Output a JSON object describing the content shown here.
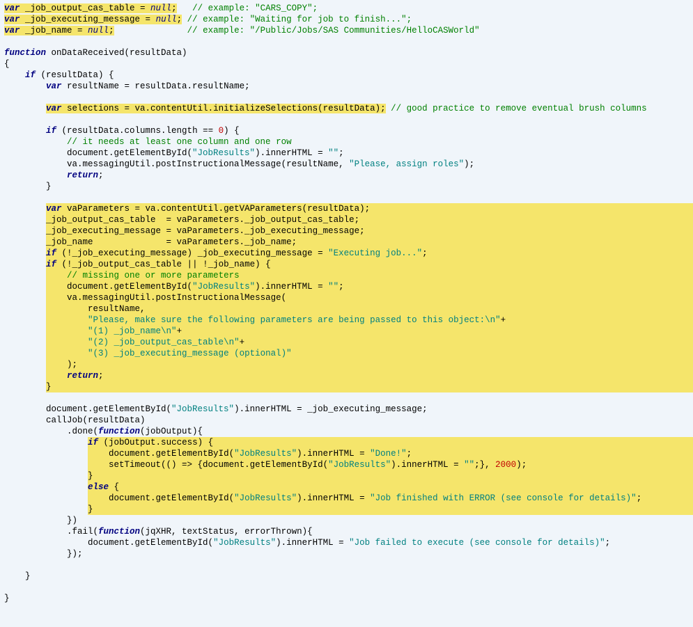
{
  "code": {
    "lines": [
      {
        "hl": true,
        "html": "<span class='kw'>var</span> _job_output_cas_table = <span class='null'>null</span>;",
        "trail": "   <span class='cmt'>// example: \"CARS_COPY\";</span>"
      },
      {
        "hl": true,
        "html": "<span class='kw'>var</span> _job_executing_message = <span class='null'>null</span>;",
        "trail": " <span class='cmt'>// example: \"Waiting for job to finish...\";</span>"
      },
      {
        "hl": true,
        "html": "<span class='kw'>var</span> _job_name = <span class='null'>null</span>;",
        "trail": "              <span class='cmt'>// example: \"/Public/Jobs/SAS Communities/HelloCASWorld\"</span>"
      },
      {
        "blank": true
      },
      {
        "html": "<span class='kw'>function</span> onDataReceived(resultData)"
      },
      {
        "html": "{"
      },
      {
        "html": "    <span class='kw'>if</span> (resultData) {"
      },
      {
        "html": "        <span class='kw'>var</span> resultName = resultData.resultName;"
      },
      {
        "blank": true
      },
      {
        "html": "        ",
        "inlinehl": "<span class='kw'>var</span> selections = va.contentUtil.initializeSelections(resultData);",
        "trail": " <span class='cmt'>// good practice to remove eventual brush columns</span>"
      },
      {
        "blank": true
      },
      {
        "html": "        <span class='kw'>if</span> (resultData.columns.length == <span class='num'>0</span>) {"
      },
      {
        "html": "            <span class='cmt'>// it needs at least one column and one row</span>"
      },
      {
        "html": "            document.getElementById(<span class='str'>\"JobResults\"</span>).innerHTML = <span class='str'>\"\"</span>;"
      },
      {
        "html": "            va.messagingUtil.postInstructionalMessage(resultName, <span class='str'>\"Please, assign roles\"</span>);"
      },
      {
        "html": "            <span class='kw'>return</span>;"
      },
      {
        "html": "        }"
      },
      {
        "blank": true
      },
      {
        "hlblock": true,
        "indent": "        ",
        "html": "<span class='kw'>var</span> vaParameters = va.contentUtil.getVAParameters(resultData);"
      },
      {
        "hlblock": true,
        "indent": "        ",
        "html": "_job_output_cas_table  = vaParameters._job_output_cas_table;"
      },
      {
        "hlblock": true,
        "indent": "        ",
        "html": "_job_executing_message = vaParameters._job_executing_message;"
      },
      {
        "hlblock": true,
        "indent": "        ",
        "html": "_job_name              = vaParameters._job_name;"
      },
      {
        "hlblock": true,
        "indent": "        ",
        "html": "<span class='kw'>if</span> (!_job_executing_message) _job_executing_message = <span class='str'>\"Executing job...\"</span>;"
      },
      {
        "hlblock": true,
        "indent": "        ",
        "html": "<span class='kw'>if</span> (!_job_output_cas_table || !_job_name) {"
      },
      {
        "hlblock": true,
        "indent": "        ",
        "html": "    <span class='cmt'>// missing one or more parameters</span>"
      },
      {
        "hlblock": true,
        "indent": "        ",
        "html": "    document.getElementById(<span class='str'>\"JobResults\"</span>).innerHTML = <span class='str'>\"\"</span>;"
      },
      {
        "hlblock": true,
        "indent": "        ",
        "html": "    va.messagingUtil.postInstructionalMessage("
      },
      {
        "hlblock": true,
        "indent": "        ",
        "html": "        resultName,"
      },
      {
        "hlblock": true,
        "indent": "        ",
        "html": "        <span class='str'>\"Please, make sure the following parameters are being passed to this object:\\n\"</span>+"
      },
      {
        "hlblock": true,
        "indent": "        ",
        "html": "        <span class='str'>\"(1) _job_name\\n\"</span>+"
      },
      {
        "hlblock": true,
        "indent": "        ",
        "html": "        <span class='str'>\"(2) _job_output_cas_table\\n\"</span>+"
      },
      {
        "hlblock": true,
        "indent": "        ",
        "html": "        <span class='str'>\"(3) _job_executing_message (optional)\"</span>"
      },
      {
        "hlblock": true,
        "indent": "        ",
        "html": "    );"
      },
      {
        "hlblock": true,
        "indent": "        ",
        "html": "    <span class='kw'>return</span>;"
      },
      {
        "hlblock": true,
        "indent": "        ",
        "html": "}"
      },
      {
        "blank": true
      },
      {
        "html": "        document.getElementById(<span class='str'>\"JobResults\"</span>).innerHTML = _job_executing_message;"
      },
      {
        "html": "        callJob(resultData)"
      },
      {
        "html": "            .done(<span class='kw'>function</span>(jobOutput){"
      },
      {
        "hlblock": true,
        "indent": "                ",
        "html": "<span class='kw'>if</span> (jobOutput.success) {"
      },
      {
        "hlblock": true,
        "indent": "                ",
        "html": "    document.getElementById(<span class='str'>\"JobResults\"</span>).innerHTML = <span class='str'>\"Done!\"</span>;"
      },
      {
        "hlblock": true,
        "indent": "                ",
        "html": "    setTimeout(() =&gt; {document.getElementById(<span class='str'>\"JobResults\"</span>).innerHTML = <span class='str'>\"\"</span>;}, <span class='num'>2000</span>);"
      },
      {
        "hlblock": true,
        "indent": "                ",
        "html": "}"
      },
      {
        "hlblock": true,
        "indent": "                ",
        "html": "<span class='kw'>else</span> {"
      },
      {
        "hlblock": true,
        "indent": "                ",
        "html": "    document.getElementById(<span class='str'>\"JobResults\"</span>).innerHTML = <span class='str'>\"Job finished with ERROR (see console for details)\"</span>;"
      },
      {
        "hlblock": true,
        "indent": "                ",
        "html": "}"
      },
      {
        "html": "            })"
      },
      {
        "html": "            .fail(<span class='kw'>function</span>(jqXHR, textStatus, errorThrown){"
      },
      {
        "html": "                document.getElementById(<span class='str'>\"JobResults\"</span>).innerHTML = <span class='str'>\"Job failed to execute (see console for details)\"</span>;"
      },
      {
        "html": "            });"
      },
      {
        "blank": true
      },
      {
        "html": "    }"
      },
      {
        "blank": true
      },
      {
        "html": "}"
      }
    ]
  }
}
